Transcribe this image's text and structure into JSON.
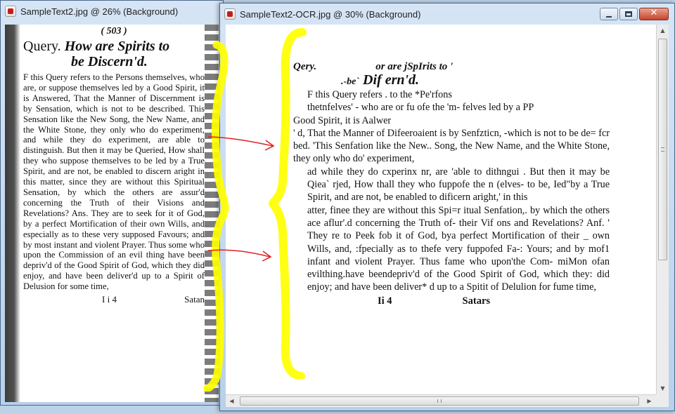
{
  "window_left": {
    "title": "SampleText2.jpg @  26% (Background)",
    "scan": {
      "page_number": "( 503 )",
      "query_label": "Query.",
      "query_title": "How are Spirits to",
      "query_title_2": "be Discern'd.",
      "body": "F this Query refers to the Persons themselves, who are, or suppose themselves led by a Good Spirit, it is Answered, That the Manner of Discernment is by Sensation, which is not to be described. This Sensation like the New Song, the New Name, and the White Stone, they only who do experiment, and while they do experiment, are able to distinguish. But then it may be Queried, How shall they who suppose themselves to be led by a True Spirit, and are not, be enabled to discern aright in this matter, since they are without this Spiritual Sensation, by which the others are assur'd concerning the Truth of their Visions and Revelations? Ans. They are to seek for it of God, by a perfect Mortification of their own Wills, and especially as to these very supposed Favours; and by most instant and violent Prayer. Thus some who upon the Commission of an evil thing have been depriv'd of the Good Spirit of God, which they did enjoy, and have been deliver'd up to a Spirit of Delusion for some time,",
      "signature": "I i 4",
      "catchword": "Satan"
    }
  },
  "window_right": {
    "title": "SampleText2-OCR.jpg @  30% (Background)",
    "ocr": {
      "line1_a": "Qery.",
      "line1_b": "or are jSpIrits to '",
      "line2_prefix": ".-be`",
      "line2_main": "Dif ern'd.",
      "line3": "F this Query refers . to the *Pe'rfons",
      "line4": "thetnfelves' - who are or fu ofe the 'm- felves led by a      PP",
      "line5": "Good Spirit, it is Aalwer",
      "body": "' d, That the Manner of Difeeroaient is by Senfzticn, -which is not to be de= fcr bed. 'This Senfation like the New.. Song, the New Name, and the White Stone, they only who do' experiment,",
      "body2": "ad while they do cxperinx nr, are 'able to dithngui . But then it may be Qiea` rjed, How thall they who fuppofe the n (elves- to be, Ied\"by a True Spirit, and are not, be enabled to dificern aright,' in this",
      "body3": "atter, finee they are without this Spi=r itual Senfation,. by which the others ace aflur'.d concerning the Truth of- their Vif ons and Revelations? Anf. ' They re to Peek fob  it of God, bya perfect Mortification of their _ own Wills, and, :fpecially as to thefe very fuppofed Fa-: Yours; and by mof1 infant and violent Prayer. Thus fame who upon'the Com- miMon ofan evilthing.have beendepriv'd of the Good Spirit of God, which they: did enjoy; and have been deliver* d up to a Spitit of Delulion for fume time,",
      "signature": "Ii 4",
      "catchword": "Satars"
    }
  },
  "colors": {
    "highlight": "#ffff00",
    "arrow": "#e02020",
    "close_button": "#c7442b"
  },
  "icons": [
    "image-file-icon",
    "minimize-icon",
    "maximize-icon",
    "close-icon",
    "scroll-up-icon",
    "scroll-down-icon",
    "scroll-left-icon",
    "scroll-right-icon"
  ]
}
